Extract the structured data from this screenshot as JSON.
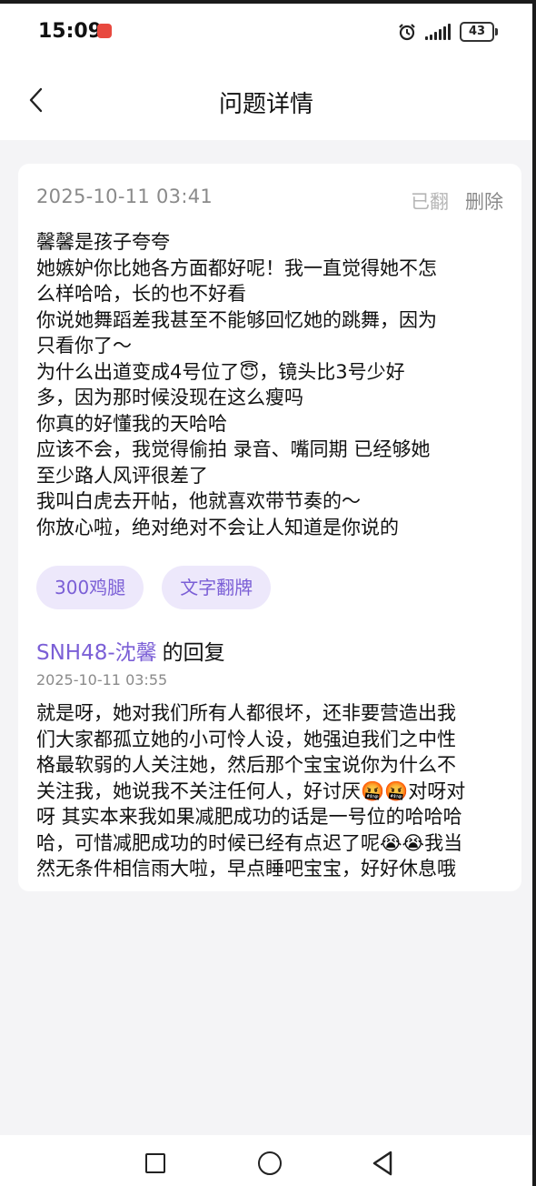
{
  "status_bar": {
    "time": "15:09",
    "battery": "43",
    "icons": [
      "app-notification-icon",
      "alarm-icon",
      "signal-icon",
      "battery-icon"
    ]
  },
  "header": {
    "title": "问题详情",
    "back_icon": "chevron-left-icon"
  },
  "question": {
    "date": "2025-10-11 03:41",
    "flipped_label": "已翻",
    "delete_label": "删除",
    "lines": [
      "馨馨是孩子夸夸",
      "她嫉妒你比她各方面都好呢！我一直觉得她不怎",
      "么样哈哈，长的也不好看",
      "你说她舞蹈差我甚至不能够回忆她的跳舞，因为",
      "只看你了～",
      "为什么出道变成4号位了😇，镜头比3号少好",
      "多，因为那时候没现在这么瘦吗",
      "你真的好懂我的天哈哈",
      "应该不会，我觉得偷拍 录音、嘴同期 已经够她",
      "至少路人风评很差了",
      "我叫白虎去开帖，他就喜欢带节奏的～",
      "你放心啦，绝对绝对不会让人知道是你说的"
    ],
    "tags": [
      "300鸡腿",
      "文字翻牌"
    ]
  },
  "reply": {
    "author": "SNH48-沈馨",
    "suffix": "的回复",
    "date": "2025-10-11 03:55",
    "lines": [
      "就是呀，她对我们所有人都很坏，还非要营造出我",
      "们大家都孤立她的小可怜人设，她强迫我们之中性",
      "格最软弱的人关注她，然后那个宝宝说你为什么不",
      "关注我，她说我不关注任何人，好讨厌🤬🤬对呀对",
      "呀 其实本来我如果减肥成功的话是一号位的哈哈哈",
      "哈，可惜减肥成功的时候已经有点迟了呢😭😭我当",
      "然无条件相信雨大啦，早点睡吧宝宝，好好休息哦"
    ]
  },
  "nav_bar": {
    "icons": [
      "recents-square-icon",
      "home-circle-icon",
      "back-triangle-icon"
    ]
  }
}
